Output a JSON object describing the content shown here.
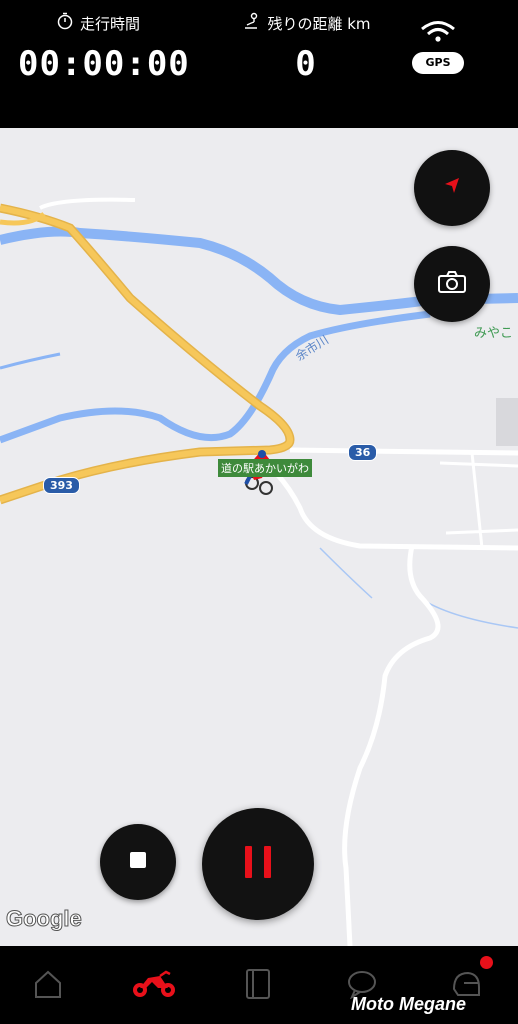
{
  "status": {
    "elapsed_label": "走行時間",
    "elapsed_value": "00:00:00",
    "remaining_label": "残りの距離 km",
    "remaining_value": "0",
    "gps_label": "GPS"
  },
  "map": {
    "place_label": "道の駅あかいがわ",
    "route_36": "36",
    "route_393": "393",
    "river_label": "余市川",
    "town_label": "みやこ",
    "attribution": "Google"
  },
  "controls": {
    "recenter_icon": "navigation-arrow-icon",
    "camera_icon": "camera-icon",
    "stop_icon": "stop-icon",
    "pause_icon": "pause-icon"
  },
  "nav": {
    "items": [
      {
        "icon": "home-icon",
        "active": false
      },
      {
        "icon": "motorcycle-icon",
        "active": true
      },
      {
        "icon": "notebook-icon",
        "active": false
      },
      {
        "icon": "chat-icon",
        "active": false
      },
      {
        "icon": "helmet-icon",
        "active": false
      }
    ],
    "brand": "Moto Megane"
  },
  "colors": {
    "accent": "#e8101a",
    "road_major": "#f6c75a",
    "river": "#8ab4f5",
    "map_bg": "#ececef",
    "place_green": "#3e8a3b",
    "route_blue": "#2a5ca8"
  }
}
